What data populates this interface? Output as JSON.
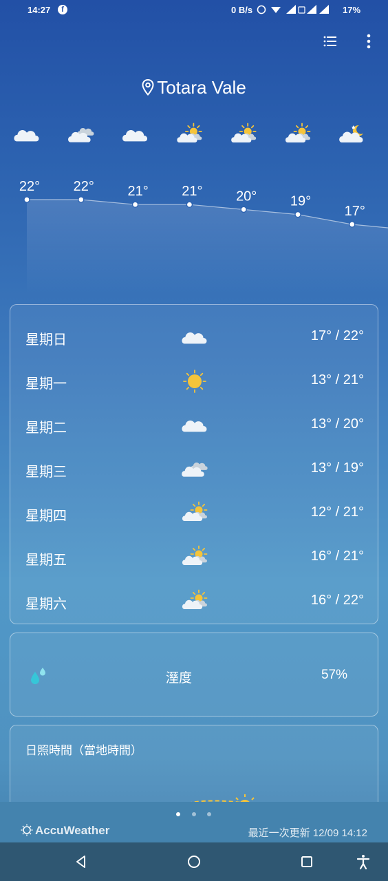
{
  "status_bar": {
    "time": "14:27",
    "net_speed": "0 B/s",
    "battery": "17%"
  },
  "location": {
    "name": "Totara Vale",
    "icon": "location-pin-icon"
  },
  "hourly": {
    "icons": [
      "cloudy",
      "mostly-cloudy",
      "cloudy",
      "partly-sunny",
      "partly-sunny",
      "partly-sunny",
      "partly-cloudy-night"
    ],
    "temps": [
      "22°",
      "22°",
      "21°",
      "21°",
      "20°",
      "19°",
      "17°"
    ],
    "values": [
      22,
      22,
      21,
      21,
      20,
      19,
      17
    ]
  },
  "daily": [
    {
      "day": "星期日",
      "icon": "cloudy",
      "range": "17° / 22°"
    },
    {
      "day": "星期一",
      "icon": "sunny",
      "range": "13° / 21°"
    },
    {
      "day": "星期二",
      "icon": "cloudy",
      "range": "13° / 20°"
    },
    {
      "day": "星期三",
      "icon": "mostly-cloudy",
      "range": "13° / 19°"
    },
    {
      "day": "星期四",
      "icon": "partly-sunny",
      "range": "12° / 21°"
    },
    {
      "day": "星期五",
      "icon": "partly-sunny",
      "range": "16° / 21°"
    },
    {
      "day": "星期六",
      "icon": "partly-sunny",
      "range": "16° / 22°"
    }
  ],
  "humidity": {
    "label": "溼度",
    "value": "57%"
  },
  "sunshine": {
    "title": "日照時間（當地時間）"
  },
  "footer": {
    "brand": "AccuWeather",
    "updated": "最近一次更新 12/09 14:12"
  },
  "colors": {
    "sun": "#f5c43a",
    "drop": "#36c6d8",
    "cloud": "#eef3f8"
  }
}
